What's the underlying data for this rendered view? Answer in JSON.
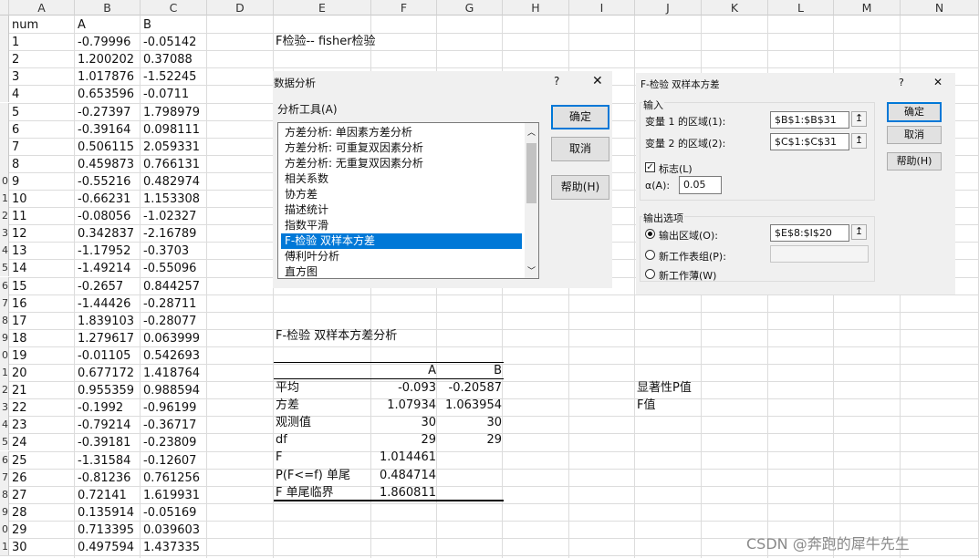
{
  "grid": {
    "columns": [
      "A",
      "B",
      "C",
      "D",
      "E",
      "F",
      "G",
      "H",
      "I",
      "J",
      "K",
      "L",
      "M",
      "N"
    ],
    "row_header_digits": [
      "",
      "",
      "",
      "",
      "",
      "",
      "",
      "",
      "",
      "0",
      "1",
      "2",
      "3",
      "4",
      "5",
      "6",
      "7",
      "8",
      "9",
      "0",
      "1",
      "2",
      "3",
      "4",
      "5",
      "6",
      "7",
      "8",
      "9",
      "0",
      "1"
    ],
    "table_header": [
      "num",
      "A",
      "B"
    ],
    "rows": [
      [
        "1",
        "-0.79996",
        "-0.05142"
      ],
      [
        "2",
        "1.200202",
        "0.37088"
      ],
      [
        "3",
        "1.017876",
        "-1.52245"
      ],
      [
        "4",
        "0.653596",
        "-0.0711"
      ],
      [
        "5",
        "-0.27397",
        "1.798979"
      ],
      [
        "6",
        "-0.39164",
        "0.098111"
      ],
      [
        "7",
        "0.506115",
        "2.059331"
      ],
      [
        "8",
        "0.459873",
        "0.766131"
      ],
      [
        "9",
        "-0.55216",
        "0.482974"
      ],
      [
        "10",
        "-0.66231",
        "1.153308"
      ],
      [
        "11",
        "-0.08056",
        "-1.02327"
      ],
      [
        "12",
        "0.342837",
        "-2.16789"
      ],
      [
        "13",
        "-1.17952",
        "-0.3703"
      ],
      [
        "14",
        "-1.49214",
        "-0.55096"
      ],
      [
        "15",
        "-0.2657",
        "0.844257"
      ],
      [
        "16",
        "-1.44426",
        "-0.28711"
      ],
      [
        "17",
        "1.839103",
        "-0.28077"
      ],
      [
        "18",
        "1.279617",
        "0.063999"
      ],
      [
        "19",
        "-0.01105",
        "0.542693"
      ],
      [
        "20",
        "0.677172",
        "1.418764"
      ],
      [
        "21",
        "0.955359",
        "0.988594"
      ],
      [
        "22",
        "-0.1992",
        "-0.96199"
      ],
      [
        "23",
        "-0.79214",
        "-0.36717"
      ],
      [
        "24",
        "-0.39181",
        "-0.23809"
      ],
      [
        "25",
        "-1.31584",
        "-0.12607"
      ],
      [
        "26",
        "-0.81236",
        "0.761256"
      ],
      [
        "27",
        "0.72141",
        "1.619931"
      ],
      [
        "28",
        "0.135914",
        "-0.05169"
      ],
      [
        "29",
        "0.713395",
        "0.039603"
      ],
      [
        "30",
        "0.497594",
        "1.437335"
      ]
    ]
  },
  "sheet_text": {
    "heading": "F检验-- fisher检验",
    "result_title": "F-检验 双样本方差分析",
    "pvalue_label": "显著性P值",
    "fvalue_label": "F值"
  },
  "result_table": {
    "col_headers": [
      "A",
      "B"
    ],
    "rows": [
      {
        "label": "平均",
        "a": "-0.093",
        "b": "-0.20587"
      },
      {
        "label": "方差",
        "a": "1.07934",
        "b": "1.063954"
      },
      {
        "label": "观测值",
        "a": "30",
        "b": "30"
      },
      {
        "label": "df",
        "a": "29",
        "b": "29"
      },
      {
        "label": "F",
        "a": "1.014461",
        "b": ""
      },
      {
        "label": "P(F<=f) 单尾",
        "a": "0.484714",
        "b": ""
      },
      {
        "label": "F 单尾临界",
        "a": "1.860811",
        "b": ""
      }
    ]
  },
  "analysis_dialog": {
    "title": "数据分析",
    "help_glyph": "?",
    "close_glyph": "✕",
    "tools_label": "分析工具(A)",
    "tools": [
      "方差分析: 单因素方差分析",
      "方差分析: 可重复双因素分析",
      "方差分析: 无重复双因素分析",
      "相关系数",
      "协方差",
      "描述统计",
      "指数平滑",
      "F-检验 双样本方差",
      "傅利叶分析",
      "直方图"
    ],
    "selected_index": 7,
    "ok_label": "确定",
    "cancel_label": "取消",
    "help_label": "帮助(H)"
  },
  "ftest_dialog": {
    "title": "F-检验 双样本方差",
    "help_glyph": "?",
    "close_glyph": "✕",
    "input_group": "输入",
    "var1_label": "变量 1 的区域(1):",
    "var1_value": "$B$1:$B$31",
    "var2_label": "变量 2 的区域(2):",
    "var2_value": "$C$1:$C$31",
    "labels_label": "标志(L)",
    "labels_checked": true,
    "alpha_label": "α(A):",
    "alpha_value": "0.05",
    "output_group": "输出选项",
    "out_range_label": "输出区域(O):",
    "out_range_value": "$E$8:$I$20",
    "new_sheet_label": "新工作表组(P):",
    "new_sheet_value": "",
    "new_book_label": "新工作薄(W)",
    "ok_label": "确定",
    "cancel_label": "取消",
    "help_label": "帮助(H)",
    "ref_glyph": "↥"
  },
  "watermark": "CSDN @奔跑的犀牛先生"
}
